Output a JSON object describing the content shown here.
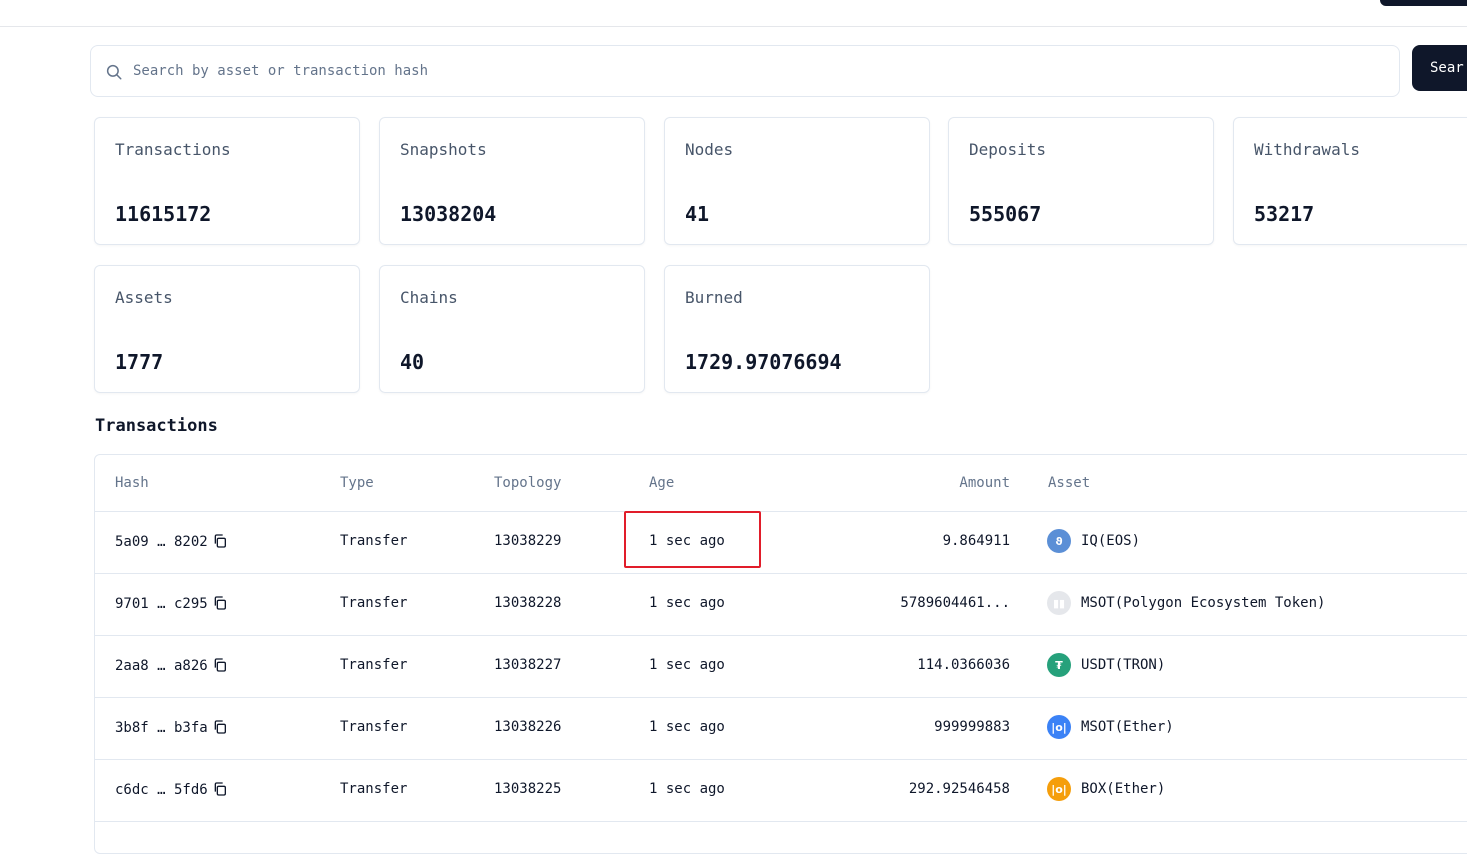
{
  "search": {
    "placeholder": "Search by asset or transaction hash",
    "button_label": "Sear"
  },
  "stats": [
    {
      "label": "Transactions",
      "value": "11615172"
    },
    {
      "label": "Snapshots",
      "value": "13038204"
    },
    {
      "label": "Nodes",
      "value": "41"
    },
    {
      "label": "Deposits",
      "value": "555067"
    },
    {
      "label": "Withdrawals",
      "value": "53217"
    },
    {
      "label": "Assets",
      "value": "1777"
    },
    {
      "label": "Chains",
      "value": "40"
    },
    {
      "label": "Burned",
      "value": "1729.97076694"
    }
  ],
  "transactions": {
    "title": "Transactions",
    "headers": {
      "hash": "Hash",
      "type": "Type",
      "topology": "Topology",
      "age": "Age",
      "amount": "Amount",
      "asset": "Asset"
    },
    "rows": [
      {
        "hash": "5a09 … 8202",
        "type": "Transfer",
        "topology": "13038229",
        "age": "1 sec ago",
        "amount": "9.864911",
        "asset": "IQ(EOS)",
        "icon_color": "#5b8fd6",
        "icon_glyph": "ϑ"
      },
      {
        "hash": "9701 … c295",
        "type": "Transfer",
        "topology": "13038228",
        "age": "1 sec ago",
        "amount": "5789604461...",
        "asset": "MSOT(Polygon Ecosystem Token)",
        "icon_color": "#e5e7eb",
        "icon_glyph": "▮▮"
      },
      {
        "hash": "2aa8 … a826",
        "type": "Transfer",
        "topology": "13038227",
        "age": "1 sec ago",
        "amount": "114.0366036",
        "asset": "USDT(TRON)",
        "icon_color": "#26a17b",
        "icon_glyph": "₮"
      },
      {
        "hash": "3b8f … b3fa",
        "type": "Transfer",
        "topology": "13038226",
        "age": "1 sec ago",
        "amount": "999999883",
        "asset": "MSOT(Ether)",
        "icon_color": "#3b82f6",
        "icon_glyph": "|o|"
      },
      {
        "hash": "c6dc … 5fd6",
        "type": "Transfer",
        "topology": "13038225",
        "age": "1 sec ago",
        "amount": "292.92546458",
        "asset": "BOX(Ether)",
        "icon_color": "#f59e0b",
        "icon_glyph": "|o|"
      }
    ]
  },
  "annotation": {
    "highlight_color": "#e11d2a"
  }
}
